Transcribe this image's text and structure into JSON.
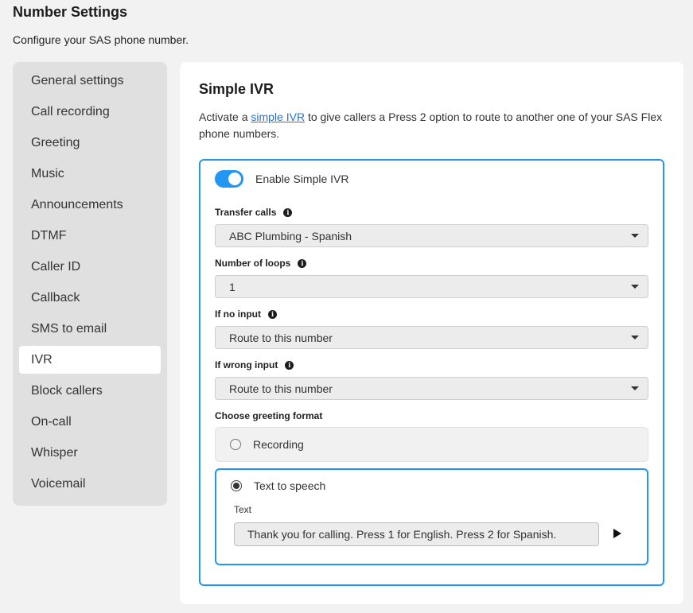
{
  "page": {
    "title": "Number Settings",
    "subtitle": "Configure your SAS phone number."
  },
  "sidebar": {
    "items": [
      {
        "label": "General settings"
      },
      {
        "label": "Call recording"
      },
      {
        "label": "Greeting"
      },
      {
        "label": "Music"
      },
      {
        "label": "Announcements"
      },
      {
        "label": "DTMF"
      },
      {
        "label": "Caller ID"
      },
      {
        "label": "Callback"
      },
      {
        "label": "SMS to email"
      },
      {
        "label": "IVR",
        "active": true
      },
      {
        "label": "Block callers"
      },
      {
        "label": "On-call"
      },
      {
        "label": "Whisper"
      },
      {
        "label": "Voicemail"
      }
    ]
  },
  "section": {
    "title": "Simple IVR",
    "desc_before": "Activate a ",
    "desc_link": "simple IVR",
    "desc_after": " to give callers a Press 2 option to route to another one of your SAS Flex phone numbers."
  },
  "ivr": {
    "enable_label": "Enable Simple IVR",
    "enabled": true,
    "transfer_calls": {
      "label": "Transfer calls",
      "value": "ABC Plumbing - Spanish"
    },
    "loops": {
      "label": "Number of loops",
      "value": "1"
    },
    "no_input": {
      "label": "If no input",
      "value": "Route to this number"
    },
    "wrong_input": {
      "label": "If wrong input",
      "value": "Route to this number"
    },
    "greeting_format_label": "Choose greeting format",
    "recording_label": "Recording",
    "tts_label": "Text to speech",
    "selected_format": "tts",
    "text_label": "Text",
    "text_value": "Thank you for calling. Press 1 for English. Press 2 for Spanish."
  },
  "icons": {
    "info": "info-icon",
    "caret": "chevron-down-icon",
    "play": "play-icon"
  },
  "colors": {
    "accent": "#2196f3",
    "link": "#1e73d8"
  }
}
